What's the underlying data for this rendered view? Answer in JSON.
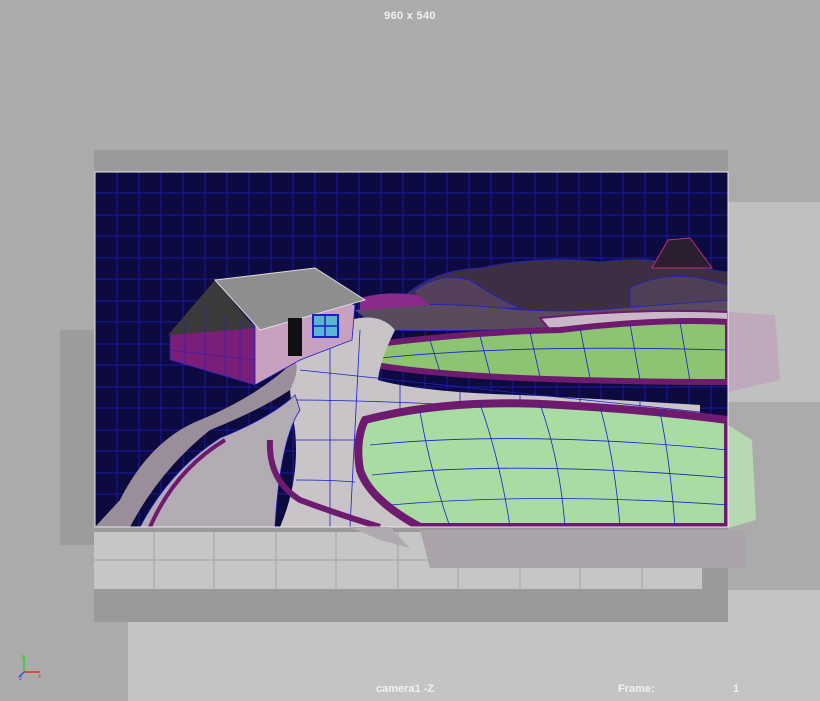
{
  "viewport": {
    "resolution_label": "960 x 540",
    "camera_label": "camera1 -Z",
    "frame_label": "Frame:",
    "frame_value": "1"
  },
  "scene": {
    "sky_color": "#0c0a3e",
    "grid_color": "#1e1ec8",
    "field_color": "#a8dca2",
    "field_far_color": "#8cc472",
    "border_color": "#6e1a6e",
    "road_color": "#c8c4c8",
    "hill_color": "#4a3a4e",
    "house_wall_color": "#c8a0c0"
  },
  "icons": {
    "axis_indicator": "xyz-axis-icon"
  }
}
